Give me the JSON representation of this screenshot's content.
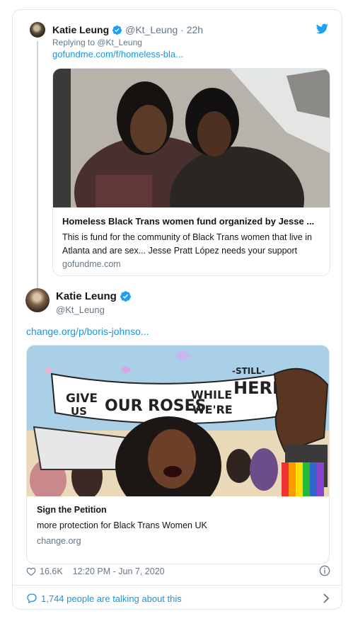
{
  "parent_tweet": {
    "name": "Katie Leung",
    "handle_time": "@Kt_Leung · 22h",
    "replying_to": "Replying to @Kt_Leung",
    "link": "gofundme.com/f/homeless-bla...",
    "card": {
      "title": "Homeless Black Trans women fund organized by Jesse ...",
      "description": "This is fund for the community of Black Trans women that live in Atlanta and are sex... Jesse Pratt López needs your support",
      "domain": "gofundme.com"
    }
  },
  "main_tweet": {
    "name": "Katie Leung",
    "handle": "@Kt_Leung",
    "link": "change.org/p/boris-johnso...",
    "card": {
      "banner_text": [
        "GIVE",
        "US",
        "OUR ROSES",
        "WHILE",
        "-STILL-",
        "WE'RE",
        "HERE"
      ],
      "title": "Sign the Petition",
      "description": "more protection for Black Trans Women UK",
      "domain": "change.org"
    },
    "likes": "16.6K",
    "timestamp": "12:20 PM - Jun 7, 2020"
  },
  "conversation": {
    "label": "1,744 people are talking about this"
  },
  "icons": {
    "verified": "verified-badge-icon",
    "brand": "twitter-bird-icon",
    "like": "heart-icon",
    "info": "info-icon",
    "reply": "speech-bubble-icon",
    "more": "chevron-right-icon"
  },
  "colors": {
    "accent": "#1b95e0",
    "verified": "#1da1f2",
    "muted": "#657786",
    "border": "#e1e8ed"
  }
}
